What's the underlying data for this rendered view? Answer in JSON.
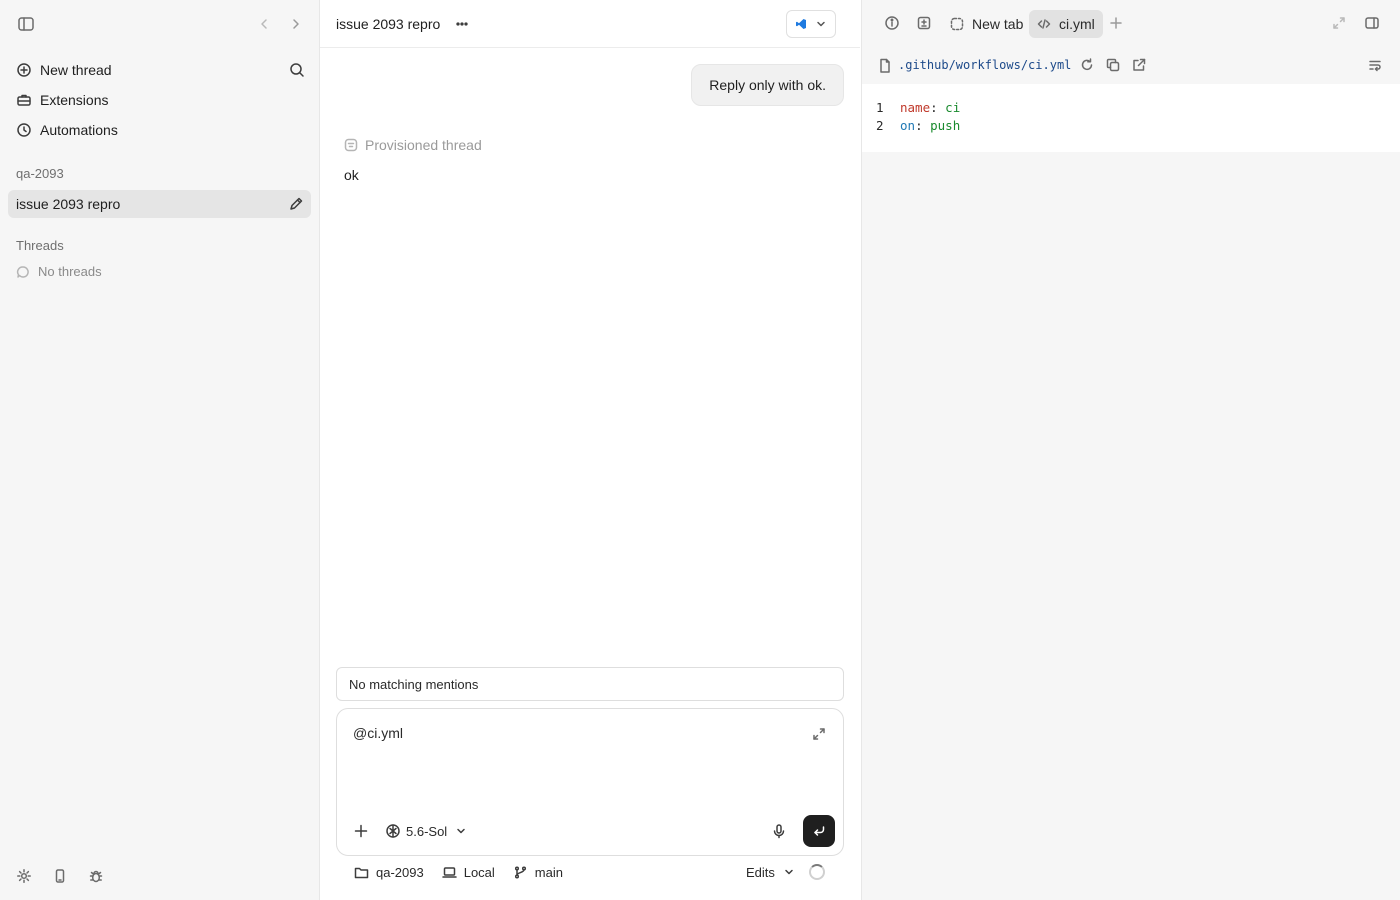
{
  "sidebar": {
    "nav": [
      {
        "label": "New thread",
        "icon": "plus-circle-icon"
      },
      {
        "label": "Extensions",
        "icon": "toolbox-icon"
      },
      {
        "label": "Automations",
        "icon": "clock-icon"
      }
    ],
    "project_label": "qa-2093",
    "active_thread": "issue 2093 repro",
    "threads_label": "Threads",
    "no_threads": "No threads"
  },
  "main": {
    "thread_title": "issue 2093 repro",
    "user_message": "Reply only with ok.",
    "provisioned_label": "Provisioned thread",
    "assistant_message": "ok",
    "mentions_text": "No matching mentions",
    "composer_text": "@ci.yml",
    "model": "5.6-Sol",
    "footer": {
      "folder": "qa-2093",
      "environment": "Local",
      "branch": "main",
      "edits": "Edits"
    }
  },
  "panel": {
    "tabs": [
      {
        "label": "New tab",
        "active": false
      },
      {
        "label": "ci.yml",
        "active": true
      }
    ],
    "file_path": ".github/workflows/ci.yml",
    "code_lines": [
      {
        "num": "1",
        "key": "name",
        "value": "ci"
      },
      {
        "num": "2",
        "key": "on",
        "value": "push"
      }
    ]
  },
  "colors": {
    "sidebar_bg": "#f6f6f6",
    "send_button": "#1f1f1f",
    "yaml_key_name": "#c0392b",
    "yaml_key_on": "#1f78b4",
    "yaml_value": "#1a8a2e",
    "path_color": "#1d4a8a"
  }
}
